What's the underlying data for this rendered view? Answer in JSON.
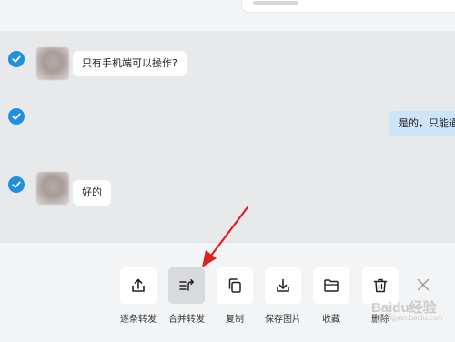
{
  "messages": [
    {
      "text": "只有手机端可以操作?",
      "side": "left",
      "selected": true
    },
    {
      "text": "是的，只能通",
      "side": "right",
      "selected": true
    },
    {
      "text": "好的",
      "side": "left",
      "selected": true
    }
  ],
  "actions": [
    {
      "label": "逐条转发",
      "icon": "share-icon"
    },
    {
      "label": "合并转发",
      "icon": "merge-forward-icon",
      "active": true
    },
    {
      "label": "复制",
      "icon": "copy-icon"
    },
    {
      "label": "保存图片",
      "icon": "download-icon"
    },
    {
      "label": "收藏",
      "icon": "folder-icon"
    },
    {
      "label": "删除",
      "icon": "trash-icon"
    }
  ],
  "close_icon": "close-icon",
  "colors": {
    "accent": "#1e8fe1",
    "annotation_arrow": "#e02020",
    "own_bubble": "#cde4fa"
  },
  "watermark": {
    "text": "Baidu经验",
    "sub": "jingyan.baidu.com"
  }
}
